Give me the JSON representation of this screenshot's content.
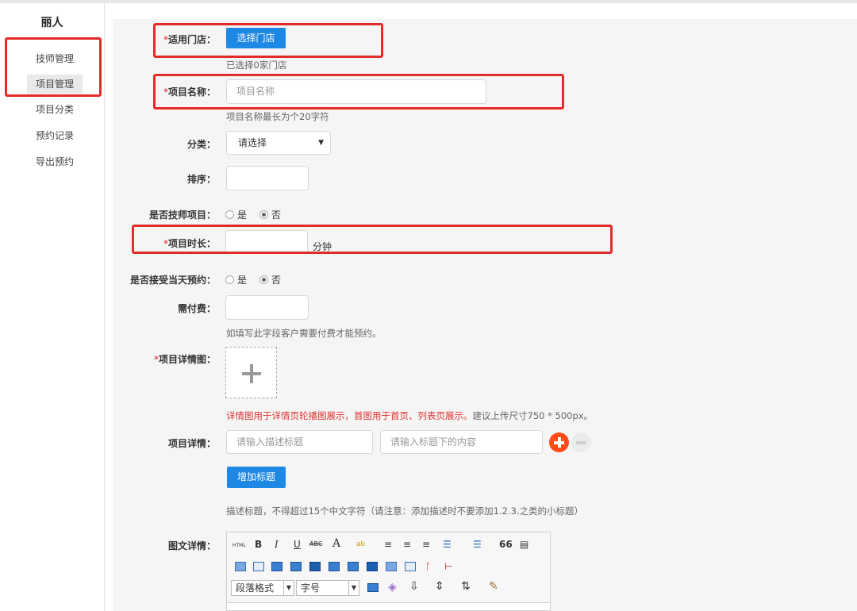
{
  "sidebar": {
    "title": "丽人",
    "items": [
      {
        "label": "技师管理"
      },
      {
        "label": "项目管理"
      },
      {
        "label": "项目分类"
      },
      {
        "label": "预约记录"
      },
      {
        "label": "导出预约"
      }
    ]
  },
  "form": {
    "store": {
      "star": "*",
      "label": "适用门店：",
      "button": "选择门店",
      "hint": "已选择0家门店"
    },
    "name": {
      "star": "*",
      "label": "项目名称：",
      "placeholder": "项目名称",
      "hint": "项目名称最长为个20字符"
    },
    "category": {
      "label": "分类：",
      "value": "请选择"
    },
    "sort": {
      "label": "排序："
    },
    "tech": {
      "label": "是否技师项目：",
      "yes": "是",
      "no": "否",
      "selected": "否"
    },
    "duration": {
      "star": "*",
      "label": "项目时长：",
      "unit": "分钟"
    },
    "sameday": {
      "label": "是否接受当天预约：",
      "yes": "是",
      "no": "否",
      "selected": "否"
    },
    "fee": {
      "label": "需付费：",
      "hint": "如填写此字段客户需要付费才能预约。"
    },
    "images": {
      "star": "*",
      "label": "项目详情图：",
      "hint": "详情图用于详情页轮播图展示，首图用于首页、列表页展示。",
      "hint_size": "建议上传尺寸750 * 500px。"
    },
    "details": {
      "label": "项目详情：",
      "title_placeholder": "请输入描述标题",
      "content_placeholder": "请输入标题下的内容",
      "add_button": "增加标题",
      "hint": "描述标题，不得超过15个中文字符（请注意：添加描述时不要添加1.2.3.之类的小标题）"
    },
    "rich": {
      "label": "图文详情：",
      "paragraph": "段落格式",
      "fontsize": "字号"
    }
  },
  "editor_row1": [
    "HTML",
    "B",
    "I",
    "U",
    "ABC",
    "A",
    "ab",
    "≡",
    "≡",
    "≡",
    "☰",
    "☰",
    "66",
    "▤"
  ],
  "colors": {
    "accent": "#1e88e5",
    "highlight": "#e52a2a",
    "add": "#ff4c19"
  }
}
